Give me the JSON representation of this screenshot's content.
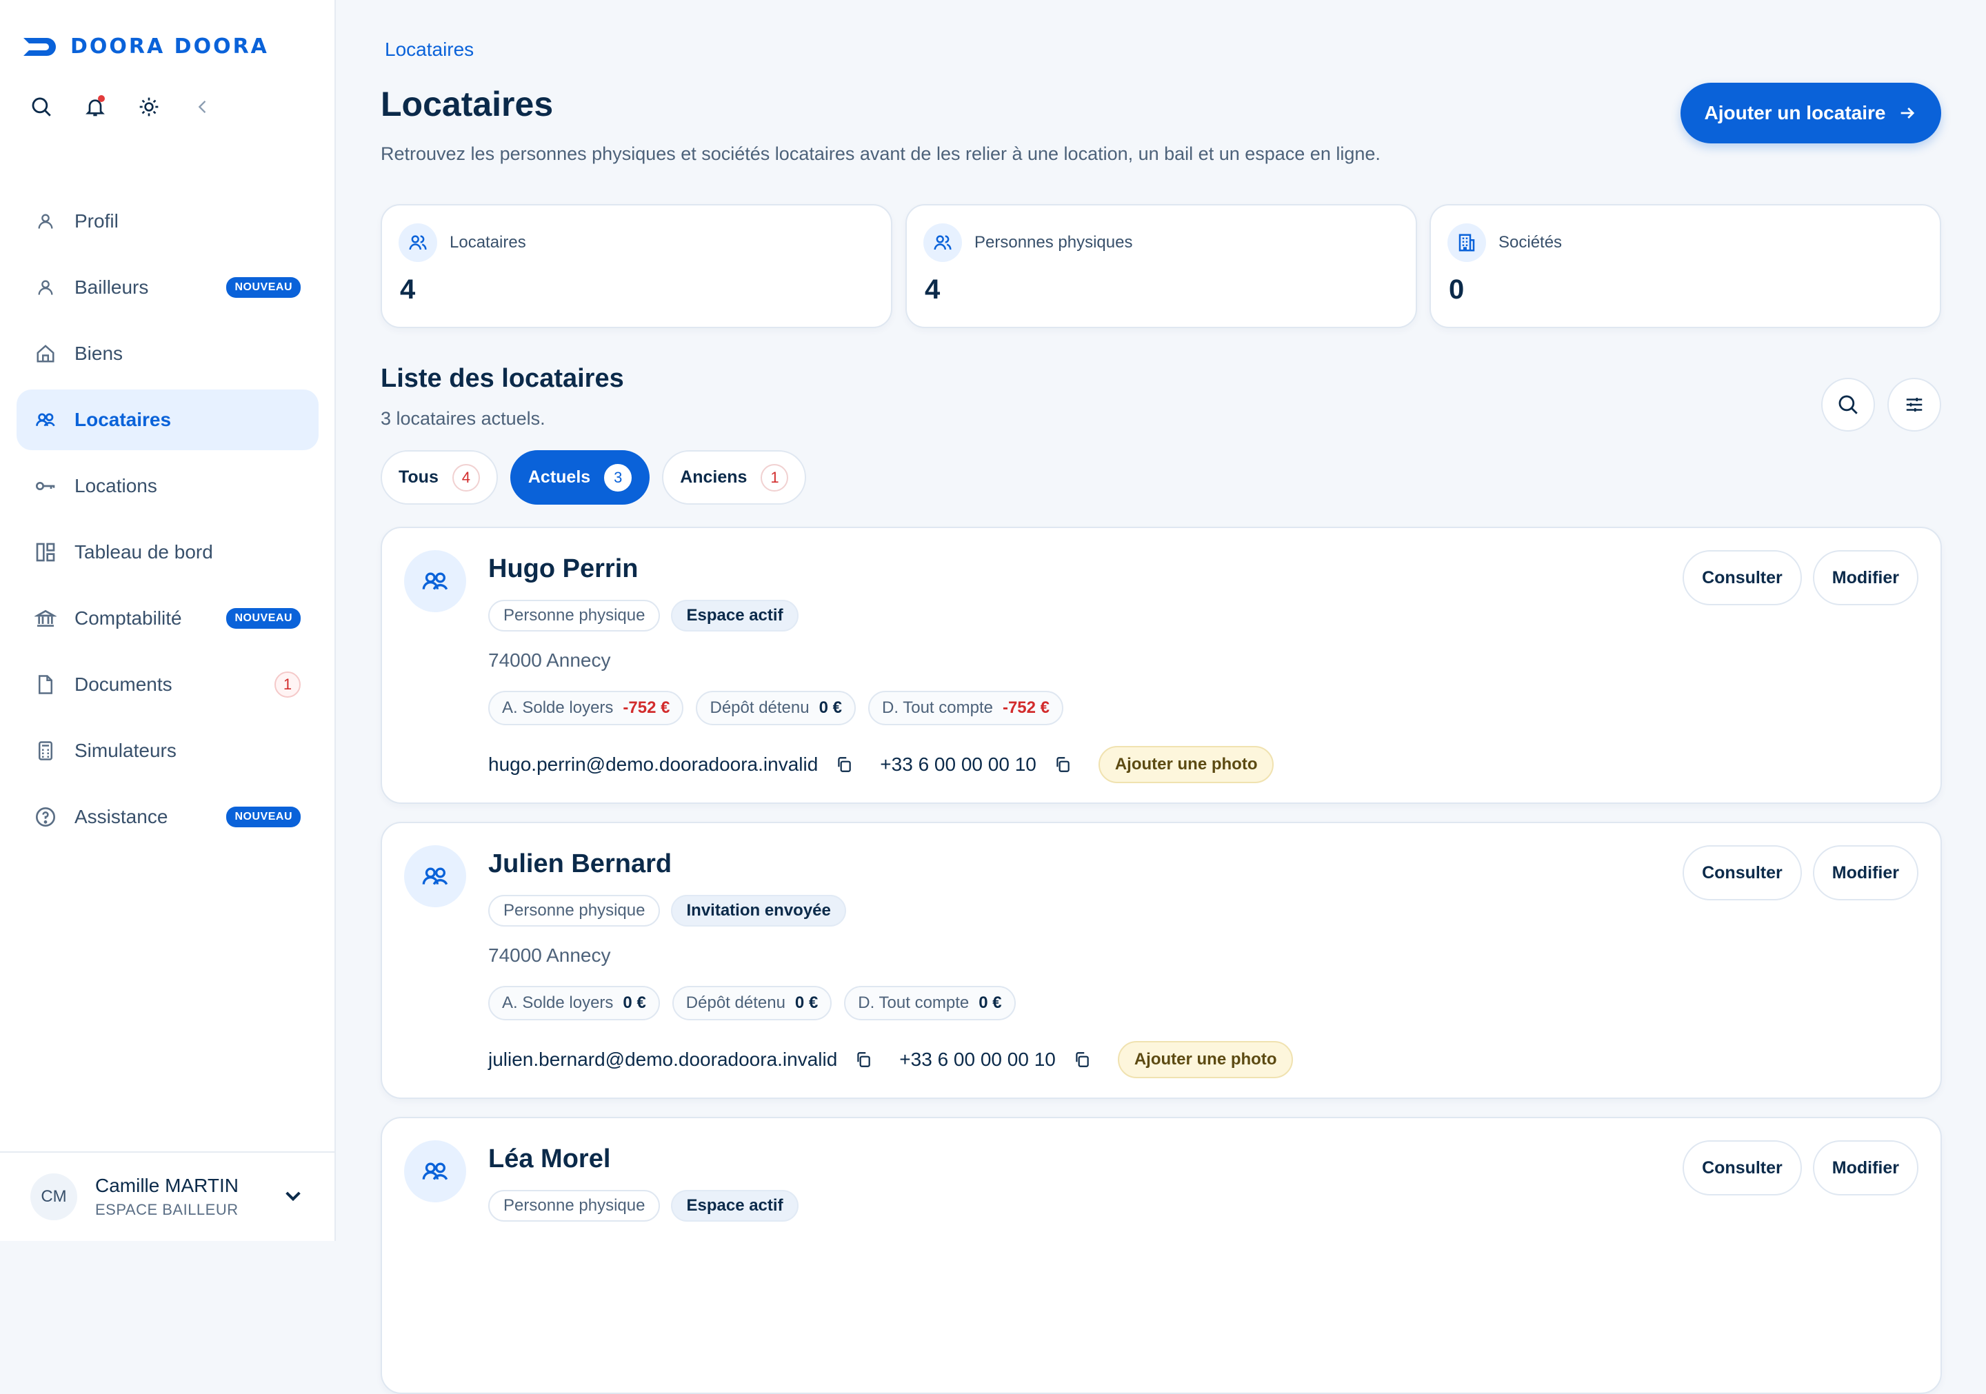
{
  "brand": {
    "name": "DOORA DOORA",
    "color": "#0a62d9"
  },
  "sidebar": {
    "tools": [
      "search-icon",
      "bell-icon",
      "sun-icon",
      "chevron-left-icon"
    ],
    "items": [
      {
        "label": "Profil",
        "icon": "user-icon"
      },
      {
        "label": "Bailleurs",
        "icon": "user-icon",
        "badge": "NOUVEAU"
      },
      {
        "label": "Biens",
        "icon": "home-icon"
      },
      {
        "label": "Locataires",
        "icon": "users-icon",
        "active": true
      },
      {
        "label": "Locations",
        "icon": "key-icon"
      },
      {
        "label": "Tableau de bord",
        "icon": "dashboard-icon"
      },
      {
        "label": "Comptabilité",
        "icon": "bank-icon",
        "badge": "NOUVEAU"
      },
      {
        "label": "Documents",
        "icon": "file-icon",
        "count": "1"
      },
      {
        "label": "Simulateurs",
        "icon": "calculator-icon"
      },
      {
        "label": "Assistance",
        "icon": "help-icon",
        "badge": "NOUVEAU"
      }
    ],
    "user": {
      "initials": "CM",
      "name": "Camille MARTIN",
      "role": "ESPACE BAILLEUR"
    }
  },
  "header": {
    "breadcrumb": "Locataires",
    "title": "Locataires",
    "subtitle": "Retrouvez les personnes physiques et sociétés locataires avant de les relier à une location, un bail et un espace en ligne.",
    "add_button": "Ajouter un locataire"
  },
  "stats": [
    {
      "label": "Locataires",
      "value": "4",
      "icon": "users-icon"
    },
    {
      "label": "Personnes physiques",
      "value": "4",
      "icon": "users-icon"
    },
    {
      "label": "Sociétés",
      "value": "0",
      "icon": "building-icon"
    }
  ],
  "list": {
    "title": "Liste des locataires",
    "subtitle": "3 locataires actuels.",
    "tabs": [
      {
        "label": "Tous",
        "count": "4"
      },
      {
        "label": "Actuels",
        "count": "3",
        "active": true
      },
      {
        "label": "Anciens",
        "count": "1"
      }
    ]
  },
  "tenants": [
    {
      "name": "Hugo Perrin",
      "type": "Personne physique",
      "status": "Espace actif",
      "city": "74000 Annecy",
      "balances": [
        {
          "label": "A. Solde loyers",
          "value": "-752 €",
          "negative": true
        },
        {
          "label": "Dépôt détenu",
          "value": "0 €",
          "negative": false
        },
        {
          "label": "D. Tout compte",
          "value": "-752 €",
          "negative": true
        }
      ],
      "email": "hugo.perrin@demo.dooradoora.invalid",
      "phone": "+33 6 00 00 00 10",
      "photo_button": "Ajouter une photo",
      "consult": "Consulter",
      "edit": "Modifier"
    },
    {
      "name": "Julien Bernard",
      "type": "Personne physique",
      "status": "Invitation envoyée",
      "city": "74000 Annecy",
      "balances": [
        {
          "label": "A. Solde loyers",
          "value": "0 €",
          "negative": false
        },
        {
          "label": "Dépôt détenu",
          "value": "0 €",
          "negative": false
        },
        {
          "label": "D. Tout compte",
          "value": "0 €",
          "negative": false
        }
      ],
      "email": "julien.bernard@demo.dooradoora.invalid",
      "phone": "+33 6 00 00 00 10",
      "photo_button": "Ajouter une photo",
      "consult": "Consulter",
      "edit": "Modifier"
    },
    {
      "name": "Léa Morel",
      "type": "Personne physique",
      "status": "Espace actif",
      "consult": "Consulter",
      "edit": "Modifier"
    }
  ]
}
